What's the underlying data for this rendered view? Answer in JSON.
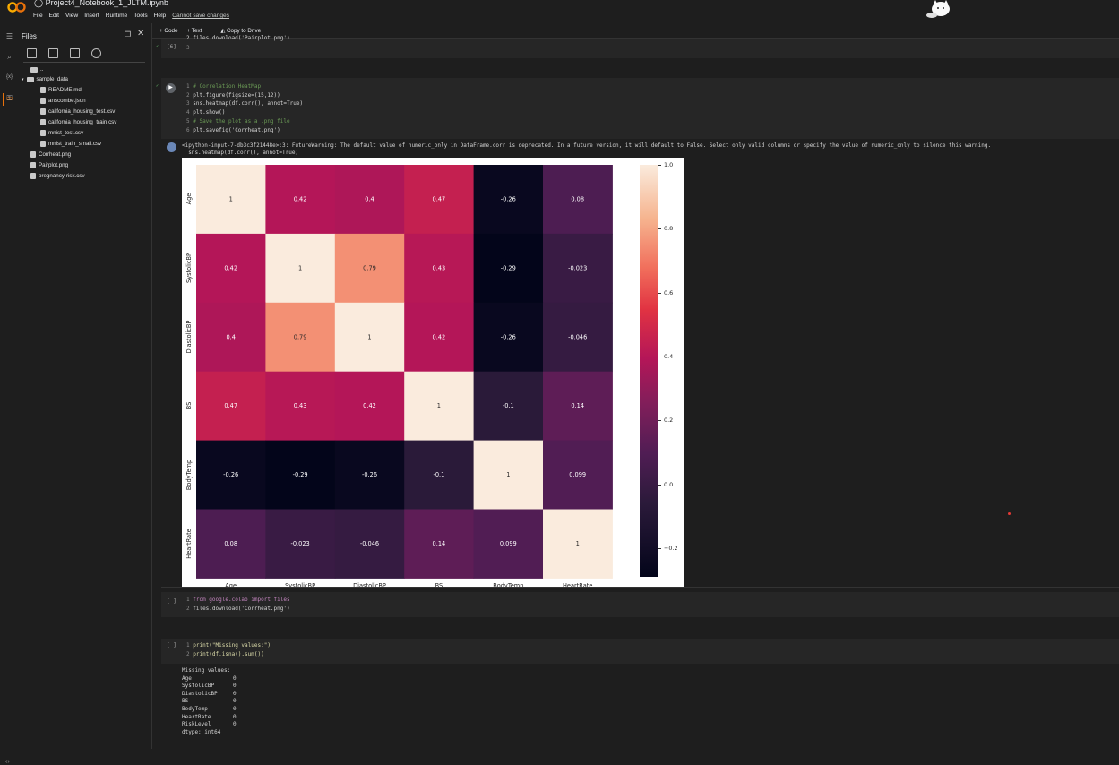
{
  "app": {
    "notebook_title": "Project4_Notebook_1_JLTM.ipynb",
    "menus": [
      "File",
      "Edit",
      "View",
      "Insert",
      "Runtime",
      "Tools",
      "Help"
    ],
    "unsaved": "Cannot save changes"
  },
  "toolbar": {
    "code_label": "+ Code",
    "text_label": "+ Text",
    "drive_label": "Copy to Drive"
  },
  "files_panel": {
    "title": "Files",
    "parent": "..",
    "items": [
      {
        "name": "sample_data",
        "type": "folder"
      },
      {
        "name": "README.md",
        "type": "file"
      },
      {
        "name": "anscombe.json",
        "type": "file"
      },
      {
        "name": "california_housing_test.csv",
        "type": "file"
      },
      {
        "name": "california_housing_train.csv",
        "type": "file"
      },
      {
        "name": "mnist_test.csv",
        "type": "file"
      },
      {
        "name": "mnist_train_small.csv",
        "type": "file"
      },
      {
        "name": "Corrheat.png",
        "type": "file"
      },
      {
        "name": "Pairplot.png",
        "type": "file"
      },
      {
        "name": "pregnancy-risk.csv",
        "type": "file"
      }
    ]
  },
  "cells": {
    "prev_exec": "[6]",
    "prev_line_num": "3",
    "prev_line_partial": "2 files.download('Pairplot.png')",
    "heatmap_lines": [
      "# Correlation HeatMap",
      "plt.figure(figsize=(15,12))",
      "sns.heatmap(df.corr(), annot=True)",
      "plt.show()",
      "# Save the plot as a .png file",
      "plt.savefig('Corrheat.png')"
    ],
    "warning_line1": "<ipython-input-7-db3c3f21448e>:3: FutureWarning: The default value of numeric_only in DataFrame.corr is deprecated. In a future version, it will default to False. Select only valid columns or specify the value of numeric_only to silence this warning.",
    "warning_line2": "  sns.heatmap(df.corr(), annot=True)",
    "download_exec": "[ ]",
    "download_lines": [
      "from google.colab import files",
      "files.download('Corrheat.png')"
    ],
    "missing_exec": "[ ]",
    "missing_lines": [
      "print(\"Missing values:\")",
      "print(df.isna().sum())"
    ],
    "missing_output_title": "Missing values:",
    "missing_output": [
      {
        "k": "Age",
        "v": "0"
      },
      {
        "k": "SystolicBP",
        "v": "0"
      },
      {
        "k": "DiastolicBP",
        "v": "0"
      },
      {
        "k": "BS",
        "v": "0"
      },
      {
        "k": "BodyTemp",
        "v": "0"
      },
      {
        "k": "HeartRate",
        "v": "0"
      },
      {
        "k": "RiskLevel",
        "v": "0"
      }
    ],
    "missing_dtype": "dtype: int64"
  },
  "chart_data": {
    "type": "heatmap",
    "title": "",
    "rows": [
      "Age",
      "SystolicBP",
      "DiastolicBP",
      "BS",
      "BodyTemp",
      "HeartRate"
    ],
    "cols": [
      "Age",
      "SystolicBP",
      "DiastolicBP",
      "BS",
      "BodyTemp",
      "HeartRate"
    ],
    "values": [
      [
        1,
        0.42,
        0.4,
        0.47,
        -0.26,
        0.08
      ],
      [
        0.42,
        1,
        0.79,
        0.43,
        -0.29,
        -0.023
      ],
      [
        0.4,
        0.79,
        1,
        0.42,
        -0.26,
        -0.046
      ],
      [
        0.47,
        0.43,
        0.42,
        1,
        -0.1,
        0.14
      ],
      [
        -0.26,
        -0.29,
        -0.26,
        -0.1,
        1,
        0.099
      ],
      [
        0.08,
        -0.023,
        -0.046,
        0.14,
        0.099,
        1
      ]
    ],
    "labels": [
      [
        "1",
        "0.42",
        "0.4",
        "0.47",
        "-0.26",
        "0.08"
      ],
      [
        "0.42",
        "1",
        "0.79",
        "0.43",
        "-0.29",
        "-0.023"
      ],
      [
        "0.4",
        "0.79",
        "1",
        "0.42",
        "-0.26",
        "-0.046"
      ],
      [
        "0.47",
        "0.43",
        "0.42",
        "1",
        "-0.1",
        "0.14"
      ],
      [
        "-0.26",
        "-0.29",
        "-0.26",
        "-0.1",
        "1",
        "0.099"
      ],
      [
        "0.08",
        "-0.023",
        "-0.046",
        "0.14",
        "0.099",
        "1"
      ]
    ],
    "colorbar_ticks": [
      1.0,
      0.8,
      0.6,
      0.4,
      0.2,
      0.0,
      -0.2
    ],
    "colorbar_tick_labels": [
      "1.0",
      "0.8",
      "0.6",
      "0.4",
      "0.2",
      "0.0",
      "−0.2"
    ],
    "vmin": -0.29,
    "vmax": 1.0,
    "colormap": "rocket"
  }
}
